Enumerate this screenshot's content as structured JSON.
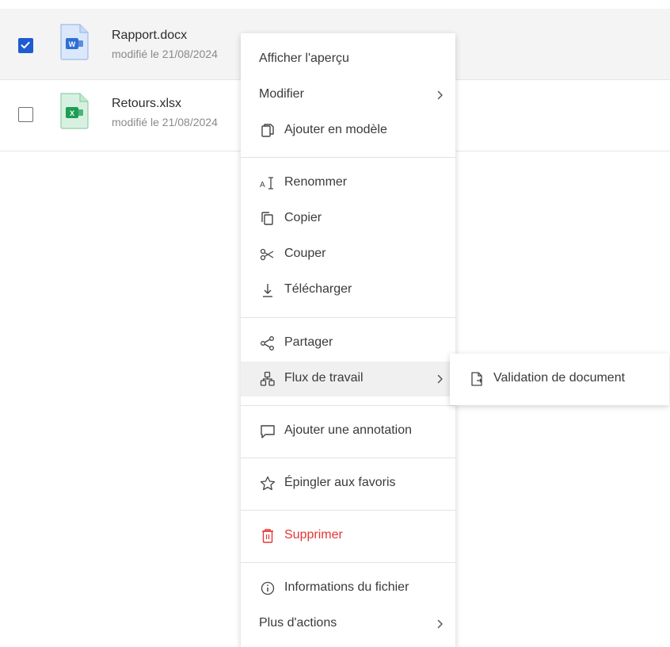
{
  "files": [
    {
      "name": "Rapport.docx",
      "meta": "modifié le 21/08/2024",
      "selected": true,
      "type": "word",
      "icon_color": "#2f6fd6"
    },
    {
      "name": "Retours.xlsx",
      "meta": "modifié le 21/08/2024",
      "selected": false,
      "type": "excel",
      "icon_color": "#1e9e53"
    }
  ],
  "context_menu": {
    "items": [
      {
        "label": "Afficher l'aperçu"
      },
      {
        "label": "Modifier",
        "has_submenu": true
      },
      {
        "label": "Ajouter en modèle",
        "icon": "template-icon"
      },
      {
        "label": "Renommer",
        "icon": "rename-icon"
      },
      {
        "label": "Copier",
        "icon": "copy-icon"
      },
      {
        "label": "Couper",
        "icon": "scissors-icon"
      },
      {
        "label": "Télécharger",
        "icon": "download-icon"
      },
      {
        "label": "Partager",
        "icon": "share-icon"
      },
      {
        "label": "Flux de travail",
        "icon": "workflow-icon",
        "has_submenu": true,
        "active": true
      },
      {
        "label": "Ajouter une annotation",
        "icon": "comment-icon"
      },
      {
        "label": "Épingler aux favoris",
        "icon": "star-icon"
      },
      {
        "label": "Supprimer",
        "icon": "trash-icon",
        "danger": true
      },
      {
        "label": "Informations du fichier",
        "icon": "info-icon"
      },
      {
        "label": "Plus d'actions",
        "has_submenu": true
      }
    ]
  },
  "workflow_submenu": {
    "items": [
      {
        "label": "Validation de document",
        "icon": "document-validate-icon"
      }
    ]
  },
  "colors": {
    "accent": "#1f5bd1",
    "danger": "#e53535",
    "hover": "#f0f0f0"
  }
}
